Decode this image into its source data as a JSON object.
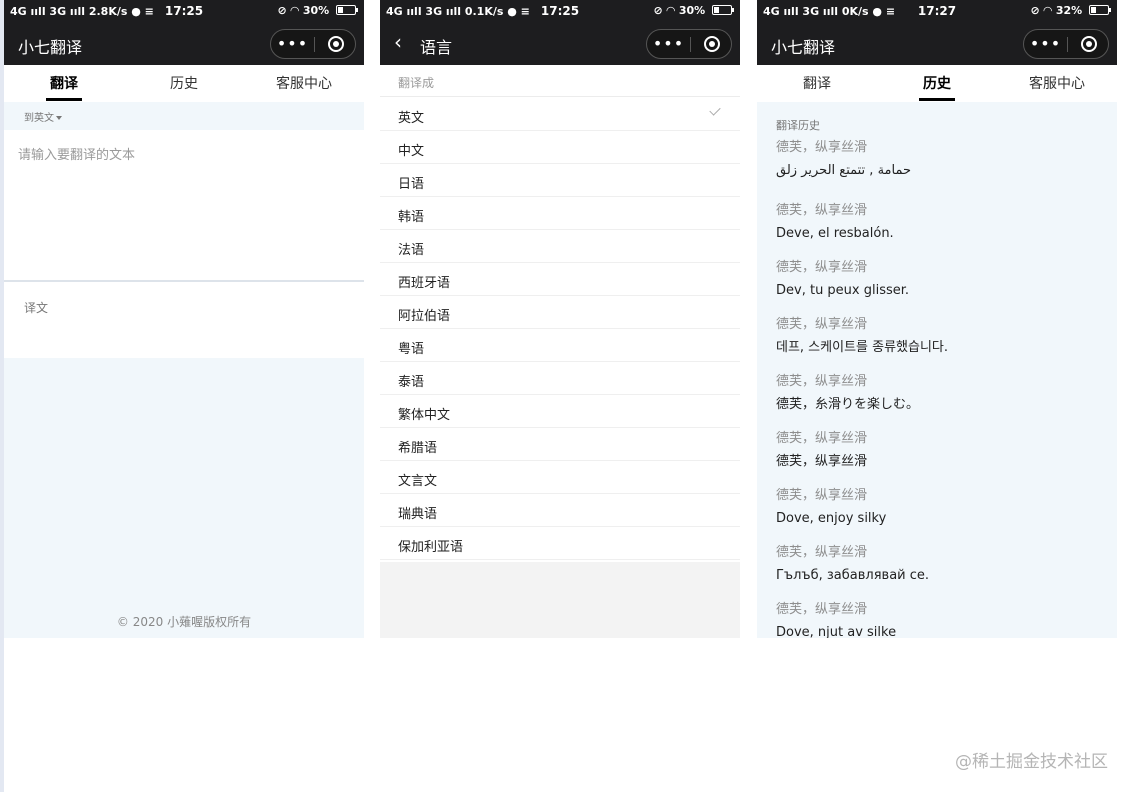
{
  "phone1": {
    "status": {
      "signal": "4G ııll 3G ııll 2.8K/s ● ≡",
      "time": "17:25",
      "battery_text": "30%",
      "battery_level": 0.3
    },
    "nav_title": "小七翻译",
    "tabs": [
      "翻译",
      "历史",
      "客服中心"
    ],
    "active_tab": 0,
    "target_lang": "到英文",
    "input_placeholder": "请输入要翻译的文本",
    "translation_label": "译文",
    "copyright": "© 2020 小薙喔版权所有"
  },
  "phone2": {
    "status": {
      "signal": "4G ııll 3G ııll 0.1K/s ● ≡",
      "time": "17:25",
      "battery_text": "30%",
      "battery_level": 0.3
    },
    "nav_title": "语言",
    "section_title": "翻译成",
    "languages": [
      "英文",
      "中文",
      "日语",
      "韩语",
      "法语",
      "西班牙语",
      "阿拉伯语",
      "粤语",
      "泰语",
      "繁体中文",
      "希腊语",
      "文言文",
      "瑞典语",
      "保加利亚语"
    ],
    "selected_language": "英文"
  },
  "phone3": {
    "status": {
      "signal": "4G ııll 3G ııll 0K/s ● ≡",
      "time": "17:27",
      "battery_text": "32%",
      "battery_level": 0.32
    },
    "nav_title": "小七翻译",
    "tabs": [
      "翻译",
      "历史",
      "客服中心"
    ],
    "active_tab": 1,
    "history_title": "翻译历史",
    "history": [
      {
        "source": "德芙，纵享丝滑",
        "result": "حمامة , تتمتع الحرير زلق"
      },
      {
        "source": "德芙，纵享丝滑",
        "result": "Deve, el resbalón."
      },
      {
        "source": "德芙，纵享丝滑",
        "result": "Dev, tu peux glisser."
      },
      {
        "source": "德芙，纵享丝滑",
        "result": "데프, 스케이트를 종류했습니다."
      },
      {
        "source": "德芙，纵享丝滑",
        "result": "德芙，糸滑りを楽しむ。"
      },
      {
        "source": "德芙，纵享丝滑",
        "result": "德芙，纵享丝滑"
      },
      {
        "source": "德芙，纵享丝滑",
        "result": "Dove, enjoy silky"
      },
      {
        "source": "德芙，纵享丝滑",
        "result": "Гълъб, забавлявай се."
      },
      {
        "source": "德芙，纵享丝滑",
        "result": "Dove, njut av silke"
      }
    ]
  },
  "watermark": "@稀土掘金技术社区"
}
